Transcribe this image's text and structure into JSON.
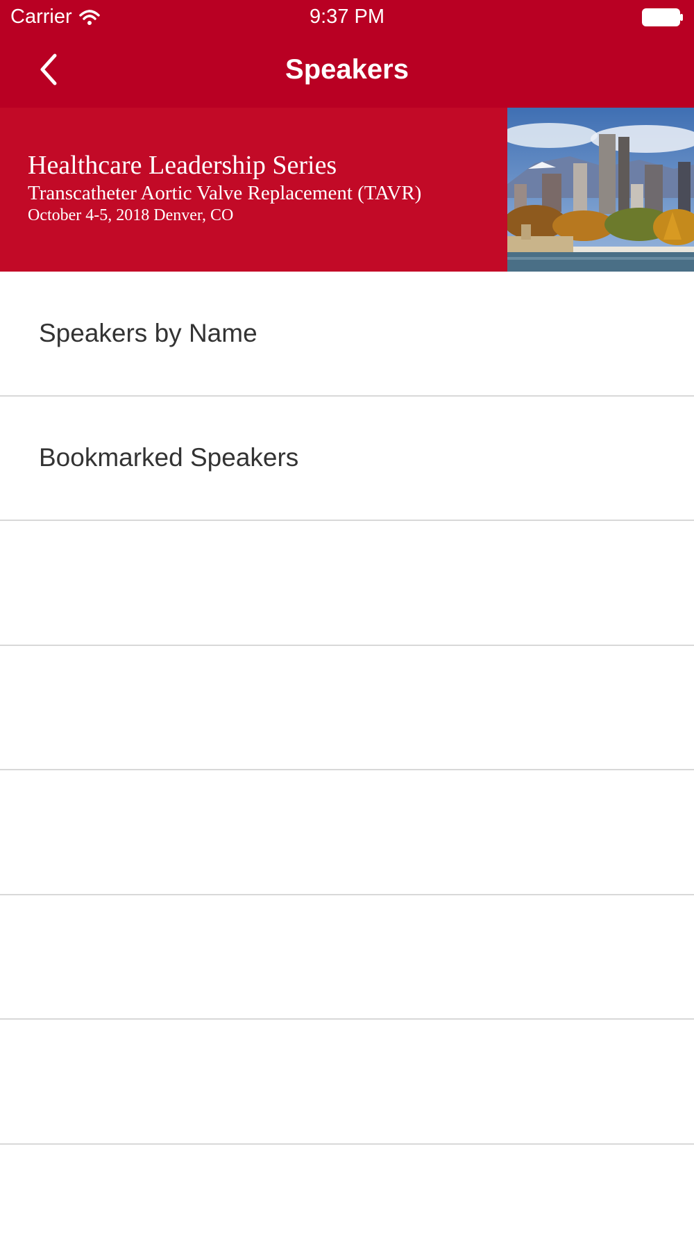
{
  "status_bar": {
    "carrier": "Carrier",
    "time": "9:37 PM",
    "icons": [
      "wifi-icon",
      "battery-icon"
    ]
  },
  "nav": {
    "title": "Speakers",
    "back_icon": "chevron-left-icon"
  },
  "banner": {
    "line1": "Healthcare Leadership Series",
    "line2": "Transcatheter Aortic Valve Replacement (TAVR)",
    "line3": "October 4-5, 2018 Denver, CO",
    "image": "denver-skyline-photo"
  },
  "menu": {
    "items": [
      {
        "label": "Speakers by Name"
      },
      {
        "label": "Bookmarked Speakers"
      }
    ]
  },
  "colors": {
    "brand_red": "#b90023",
    "banner_red": "#c20a27",
    "text": "#333333",
    "separator": "#d8d8d8"
  }
}
